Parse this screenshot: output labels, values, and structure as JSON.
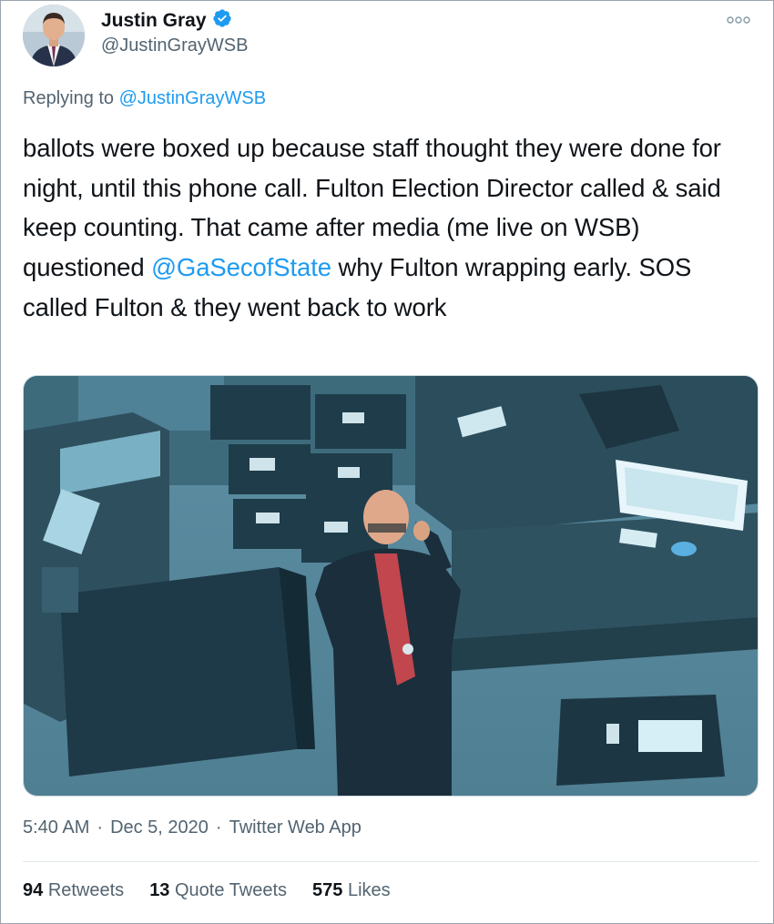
{
  "author": {
    "display_name": "Justin Gray",
    "handle": "@JustinGrayWSB",
    "verified": true
  },
  "reply": {
    "prefix": "Replying to ",
    "to_handle": "@JustinGrayWSB"
  },
  "tweet": {
    "text_part1": "ballots were boxed up because staff thought they were done for night, until this phone call. Fulton Election Director called & said keep counting. That came after media (me live on WSB) questioned ",
    "mention": "@GaSecofState",
    "text_part2": " why Fulton wrapping early. SOS called Fulton & they went back to work"
  },
  "meta": {
    "time": "5:40 AM",
    "separator": "·",
    "date": "Dec 5, 2020",
    "source": "Twitter Web App"
  },
  "stats": {
    "retweets_count": "94",
    "retweets_label": "Retweets",
    "quote_count": "13",
    "quote_label": "Quote Tweets",
    "likes_count": "575",
    "likes_label": "Likes"
  },
  "colors": {
    "link": "#1d9bf0",
    "secondary_text": "#536471",
    "primary_text": "#0f1419"
  },
  "icons": {
    "verified": "verified-badge-icon",
    "more": "more-options-icon"
  }
}
